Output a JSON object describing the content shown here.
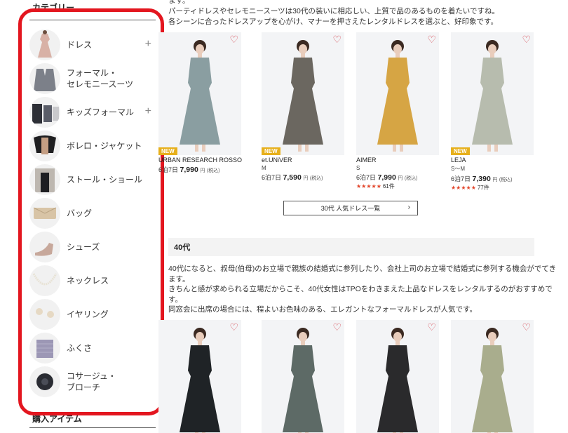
{
  "sidebar": {
    "heading": "カテゴリー",
    "items": [
      {
        "label": "ドレス",
        "has_expand": true,
        "icon": "dress-thumb-icon"
      },
      {
        "label": "フォーマル・\nセレモニースーツ",
        "has_expand": false,
        "icon": "suit-thumb-icon"
      },
      {
        "label": "キッズフォーマル",
        "has_expand": true,
        "icon": "kids-formal-thumb-icon"
      },
      {
        "label": "ボレロ・ジャケット",
        "has_expand": false,
        "icon": "bolero-thumb-icon"
      },
      {
        "label": "ストール・ショール",
        "has_expand": false,
        "icon": "stole-thumb-icon"
      },
      {
        "label": "バッグ",
        "has_expand": false,
        "icon": "bag-thumb-icon"
      },
      {
        "label": "シューズ",
        "has_expand": false,
        "icon": "shoes-thumb-icon"
      },
      {
        "label": "ネックレス",
        "has_expand": false,
        "icon": "necklace-thumb-icon"
      },
      {
        "label": "イヤリング",
        "has_expand": false,
        "icon": "earring-thumb-icon"
      },
      {
        "label": "ふくさ",
        "has_expand": false,
        "icon": "fukusa-thumb-icon"
      },
      {
        "label": "コサージュ・\nブローチ",
        "has_expand": false,
        "icon": "corsage-thumb-icon"
      }
    ],
    "expand_glyph": "+",
    "bottom_heading": "購入アイテム",
    "highlight_color": "#e3161f"
  },
  "main": {
    "intro_lines": [
      "ます。",
      "パーティドレスやセレモニースーツは30代の装いに相応しい、上質で品のあるものを着たいですね。",
      "各シーンに合ったドレスアップを心がけ、マナーを押さえたレンタルドレスを選ぶと、好印象です。"
    ],
    "products_30s": [
      {
        "brand": "URBAN RESEARCH ROSSO",
        "size": "",
        "price_prefix": "6泊7日",
        "price": "7,990",
        "unit": "円",
        "tax": "(税込)",
        "is_new": true,
        "stars": "",
        "reviews": "",
        "color": "#8a9ea1"
      },
      {
        "brand": "et.UNiVER",
        "size": "M",
        "price_prefix": "6泊7日",
        "price": "7,590",
        "unit": "円",
        "tax": "(税込)",
        "is_new": true,
        "stars": "",
        "reviews": "",
        "color": "#6b6760"
      },
      {
        "brand": "AIMER",
        "size": "S",
        "price_prefix": "6泊7日",
        "price": "7,990",
        "unit": "円",
        "tax": "(税込)",
        "is_new": false,
        "stars": "★★★★★",
        "reviews": "61件",
        "color": "#d6a544"
      },
      {
        "brand": "LEJA",
        "size": "S～M",
        "price_prefix": "6泊7日",
        "price": "7,390",
        "unit": "円",
        "tax": "(税込)",
        "is_new": true,
        "stars": "★★★★★",
        "reviews": "77件",
        "color": "#b7bcae"
      }
    ],
    "new_label": "NEW",
    "heart_glyph": "♡",
    "more_button": "30代 人気ドレス一覧",
    "more_chevron": "›",
    "section_title": "40代",
    "body_lines": [
      "40代になると、叔母(伯母)のお立場で親族の結婚式に参列したり、会社上司のお立場で結婚式に参列する機会がでてき",
      "ます。",
      "きちんと感が求められる立場だからこそ、40代女性はTPOをわきまえた上品なドレスをレンタルするのがおすすめで",
      "す。",
      "同窓会に出席の場合には、程よいお色味のある、エレガントなフォーマルドレスが人気です。"
    ],
    "products_40s_colors": [
      "#1f2326",
      "#5d6a66",
      "#2a2a2c",
      "#a9ad8d"
    ]
  }
}
